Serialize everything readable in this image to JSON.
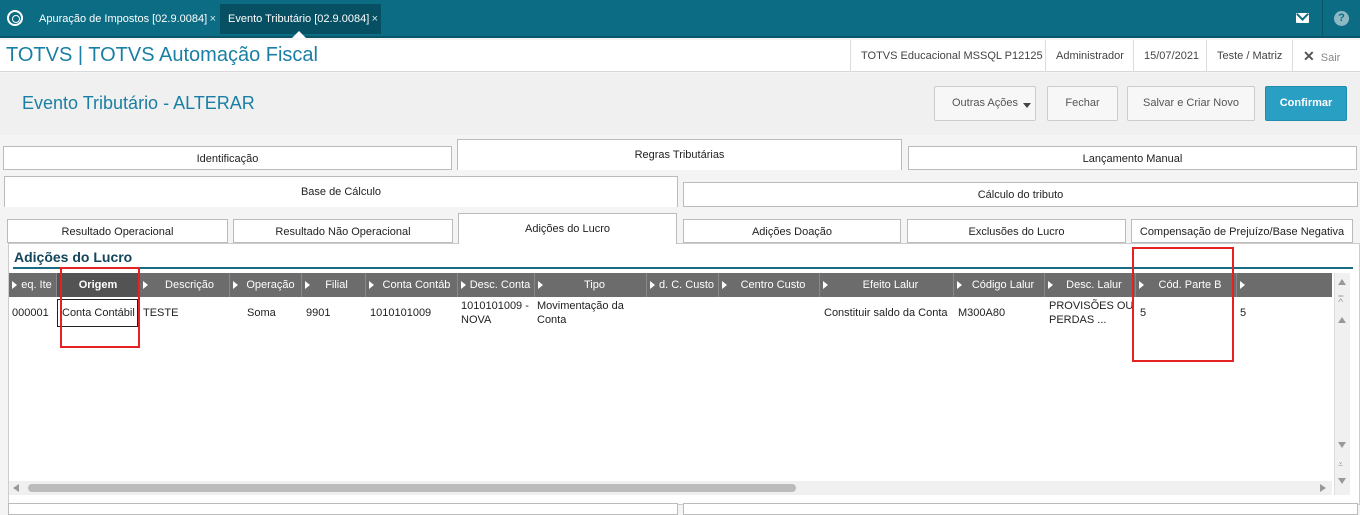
{
  "topbar": {
    "tabs": [
      {
        "label": "Apuração de Impostos [02.9.0084]"
      },
      {
        "label": "Evento Tributário [02.9.0084]"
      }
    ],
    "close_glyph": "×"
  },
  "appbar": {
    "title": "TOTVS | TOTVS Automação Fiscal",
    "environment": "TOTVS Educacional MSSQL P12125",
    "user": "Administrador",
    "date": "15/07/2021",
    "branch": "Teste / Matriz",
    "exit_label": "Sair"
  },
  "header": {
    "title": "Evento Tributário - ALTERAR",
    "buttons": {
      "outras": "Outras Ações",
      "fechar": "Fechar",
      "salvar": "Salvar e Criar Novo",
      "confirmar": "Confirmar"
    }
  },
  "tabs_level1": [
    "Identificação",
    "Regras Tributárias",
    "Lançamento Manual"
  ],
  "tabs_level2": [
    "Base de Cálculo",
    "Cálculo do tributo"
  ],
  "tabs_level3": [
    "Resultado Operacional",
    "Resultado Não Operacional",
    "Adições do Lucro",
    "Adições Doação",
    "Exclusões do Lucro",
    "Compensação de Prejuízo/Base Negativa"
  ],
  "panel": {
    "title": "Adições do Lucro"
  },
  "grid": {
    "columns": [
      "eq. Ite",
      "Origem",
      "Descrição",
      "Operação",
      "Filial",
      "Conta Contáb",
      "Desc. Conta",
      "Tipo",
      "d. C. Custo",
      "Centro Custo",
      "Efeito Lalur",
      "Código Lalur",
      "Desc. Lalur",
      "Cód. Parte B"
    ],
    "row": {
      "seq": "000001",
      "origem": "Conta Contábil",
      "descricao": "TESTE",
      "operacao": "Soma",
      "filial": "9901",
      "conta": "1010101009",
      "desc_conta_1": "1010101009 -",
      "desc_conta_2": "NOVA",
      "tipo_1": "Movimentação da",
      "tipo_2": "Conta",
      "efeito": "Constituir saldo da Conta",
      "codigo_lalur": "M300A80",
      "desc_lalur_1": "PROVISÕES OU",
      "desc_lalur_2": "PERDAS ...",
      "cod_parte_b": "5",
      "extra": "5"
    }
  },
  "colors": {
    "topbar": "#0c6c84",
    "accent": "#1a7fa4",
    "confirm": "#2a9fc4",
    "highlight": "#e52222"
  }
}
